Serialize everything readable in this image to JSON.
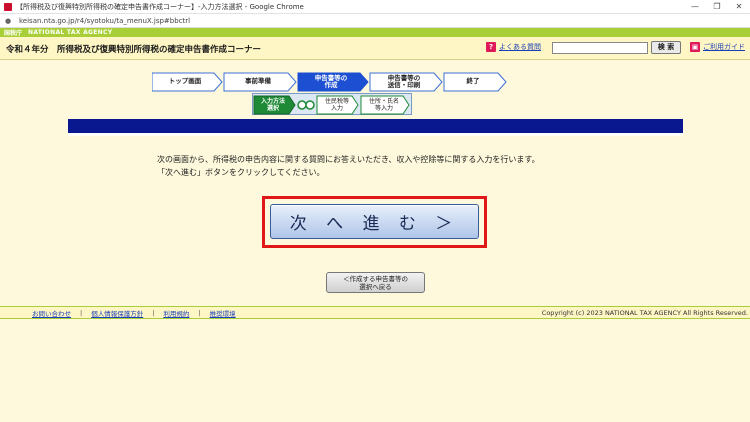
{
  "browser": {
    "window_title": "【所得税及び復興特別所得税の確定申告書作成コーナー】-入力方法選択 - Google Chrome",
    "url": "keisan.nta.go.jp/r4/syotoku/ta_menuX.jsp#bbctrl",
    "minimize_icon": "minimize-icon",
    "restore_icon": "restore-icon",
    "close_icon": "close-icon"
  },
  "agency": {
    "name": "国税庁",
    "english_name": "NATIONAL TAX AGENCY"
  },
  "header": {
    "page_title": "令和４年分　所得税及び復興特別所得税の確定申告書作成コーナー",
    "faq_label": "よくある質問",
    "search_value": "",
    "search_button": "検 索",
    "guide_label": "ご利用ガイド"
  },
  "steps": [
    {
      "label": "トップ画面",
      "state": "done"
    },
    {
      "label": "事前準備",
      "state": "done"
    },
    {
      "label": "申告書等の\n作成",
      "state": "current"
    },
    {
      "label": "申告書等の\n送信・印刷",
      "state": "todo"
    },
    {
      "label": "終了",
      "state": "todo"
    }
  ],
  "substeps": [
    {
      "label": "入力方法\n選択",
      "state": "current"
    },
    {
      "label": "住民税等\n入力",
      "state": "todo"
    },
    {
      "label": "住所・氏名\n等入力",
      "state": "todo"
    }
  ],
  "main": {
    "instruction_line1": "次の画面から、所得税の申告内容に関する質問にお答えいただき、収入や控除等に関する入力を行います。",
    "instruction_line2": "「次へ進む」ボタンをクリックしてください。",
    "next_button": "次 へ 進 む ＞",
    "back_button": "＜作成する申告書等の\n選択へ戻る"
  },
  "footer": {
    "links": [
      "お問い合わせ",
      "個人情報保護方針",
      "利用規約",
      "推奨環境"
    ],
    "copyright": "Copyright (c) 2023 NATIONAL TAX AGENCY All Rights Reserved."
  },
  "colors": {
    "page_bg": "#fef9dc",
    "header_bg": "#fef6c4",
    "brand_green": "#a9cf38",
    "blue_bar": "#0a188f",
    "step_current": "#1c4fd1",
    "substep_current": "#1f8a36",
    "highlight_red": "#e01818"
  }
}
